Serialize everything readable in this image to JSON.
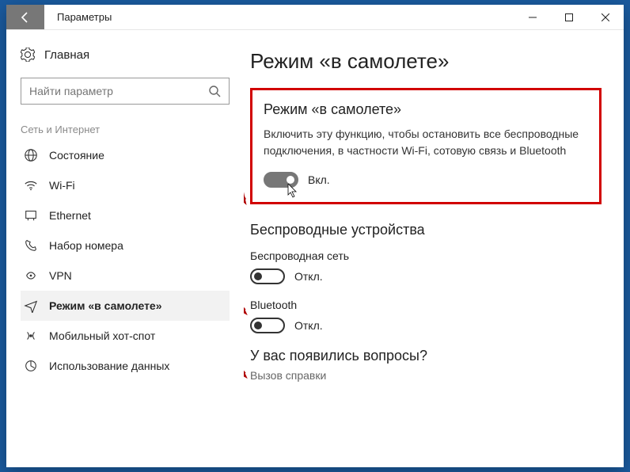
{
  "window": {
    "title": "Параметры"
  },
  "sidebar": {
    "home": "Главная",
    "search_placeholder": "Найти параметр",
    "section": "Сеть и Интернет",
    "items": [
      {
        "label": "Состояние"
      },
      {
        "label": "Wi-Fi"
      },
      {
        "label": "Ethernet"
      },
      {
        "label": "Набор номера"
      },
      {
        "label": "VPN"
      },
      {
        "label": "Режим «в самолете»"
      },
      {
        "label": "Мобильный хот-спот"
      },
      {
        "label": "Использование данных"
      }
    ]
  },
  "main": {
    "page_title": "Режим «в самолете»",
    "box": {
      "title": "Режим «в самолете»",
      "description": "Включить эту функцию, чтобы остановить все беспроводные подключения, в частности Wi-Fi, сотовую связь и Bluetooth",
      "toggle_state": "Вкл."
    },
    "wireless": {
      "heading": "Беспроводные устройства",
      "network_label": "Беспроводная сеть",
      "network_state": "Откл.",
      "bluetooth_label": "Bluetooth",
      "bluetooth_state": "Откл."
    },
    "help": {
      "heading": "У вас появились вопросы?",
      "link": "Вызов справки"
    }
  }
}
